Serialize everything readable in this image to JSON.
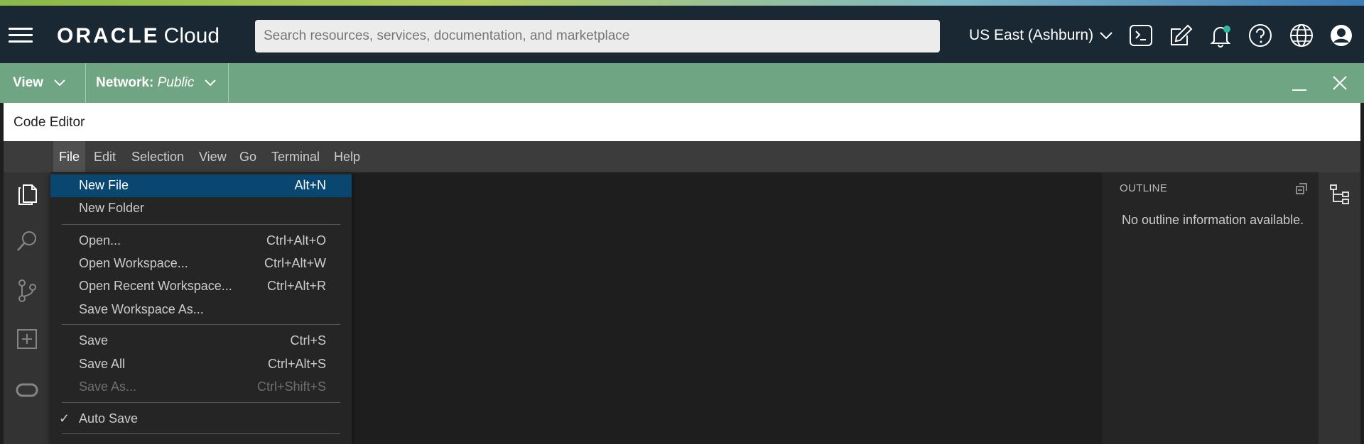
{
  "header": {
    "brand": "ORACLE",
    "product": "Cloud",
    "search_placeholder": "Search resources, services, documentation, and marketplace",
    "region": "US East (Ashburn)"
  },
  "toolbar": {
    "view_label": "View",
    "network_label": "Network:",
    "network_value": "Public"
  },
  "window": {
    "title": "Code Editor"
  },
  "menubar": {
    "items": [
      "File",
      "Edit",
      "Selection",
      "View",
      "Go",
      "Terminal",
      "Help"
    ]
  },
  "file_menu": {
    "items": [
      {
        "label": "New File",
        "shortcut": "Alt+N"
      },
      {
        "label": "New Folder",
        "shortcut": ""
      },
      {
        "label": "Open...",
        "shortcut": "Ctrl+Alt+O"
      },
      {
        "label": "Open Workspace...",
        "shortcut": "Ctrl+Alt+W"
      },
      {
        "label": "Open Recent Workspace...",
        "shortcut": "Ctrl+Alt+R"
      },
      {
        "label": "Save Workspace As...",
        "shortcut": ""
      },
      {
        "label": "Save",
        "shortcut": "Ctrl+S"
      },
      {
        "label": "Save All",
        "shortcut": "Ctrl+Alt+S"
      },
      {
        "label": "Save As...",
        "shortcut": "Ctrl+Shift+S"
      },
      {
        "label": "Auto Save",
        "shortcut": ""
      }
    ],
    "check_mark": "✓"
  },
  "outline": {
    "title": "OUTLINE",
    "message": "No outline information available."
  },
  "colors": {
    "header_bg": "#1a2833",
    "toolbar_bg": "#6fa583",
    "highlight": "#094771",
    "notification_dot": "#2fb8a0"
  }
}
